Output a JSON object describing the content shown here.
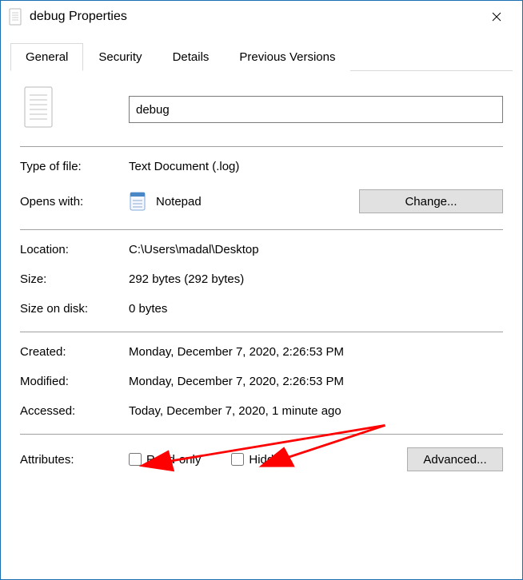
{
  "window": {
    "title": "debug Properties"
  },
  "tabs": {
    "general": "General",
    "security": "Security",
    "details": "Details",
    "previous": "Previous Versions"
  },
  "file": {
    "name": "debug",
    "type_label": "Type of file:",
    "type_value": "Text Document (.log)",
    "opens_label": "Opens with:",
    "opens_value": "Notepad",
    "change_label": "Change...",
    "location_label": "Location:",
    "location_value": "C:\\Users\\madal\\Desktop",
    "size_label": "Size:",
    "size_value": "292 bytes (292 bytes)",
    "sizeondisk_label": "Size on disk:",
    "sizeondisk_value": "0 bytes",
    "created_label": "Created:",
    "created_value": "Monday, December 7, 2020, 2:26:53 PM",
    "modified_label": "Modified:",
    "modified_value": "Monday, December 7, 2020, 2:26:53 PM",
    "accessed_label": "Accessed:",
    "accessed_value": "Today, December 7, 2020, 1 minute ago",
    "attributes_label": "Attributes:",
    "readonly_label": "Read-only",
    "hidden_label": "Hidden",
    "advanced_label": "Advanced..."
  },
  "annotation": {
    "arrow_color": "#ff0000"
  }
}
